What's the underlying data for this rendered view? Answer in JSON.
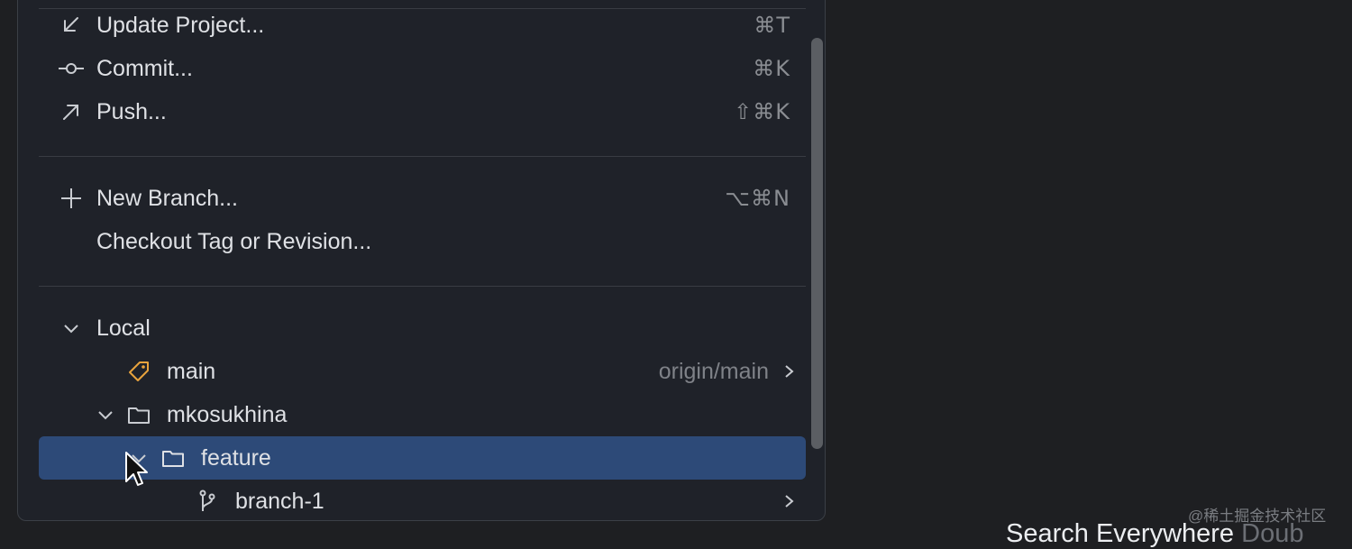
{
  "menu": {
    "actions": [
      {
        "label": "Update Project...",
        "shortcut": "⌘T",
        "icon": "update-arrow-icon"
      },
      {
        "label": "Commit...",
        "shortcut": "⌘K",
        "icon": "commit-icon"
      },
      {
        "label": "Push...",
        "shortcut": "⇧⌘K",
        "icon": "push-arrow-icon"
      }
    ],
    "branch_actions": [
      {
        "label": "New Branch...",
        "shortcut": "⌥⌘N",
        "icon": "plus-icon"
      },
      {
        "label": "Checkout Tag or Revision..."
      }
    ],
    "local": {
      "label": "Local",
      "main": {
        "label": "main",
        "tracking": "origin/main",
        "icon": "tag-icon"
      },
      "folder": {
        "label": "mkosukhina",
        "subfolder": {
          "label": "feature",
          "selected": true
        },
        "branch": {
          "label": "branch-1",
          "icon": "branch-icon"
        }
      }
    }
  },
  "status_bar": {
    "search_label": "Search Everywhere",
    "hint_partial": "Doub"
  },
  "watermark": "@稀土掘金技术社区",
  "colors": {
    "background": "#1e1f22",
    "popup": "#1f2229",
    "selection": "#2d4a78",
    "tag_accent": "#e8a33d"
  }
}
